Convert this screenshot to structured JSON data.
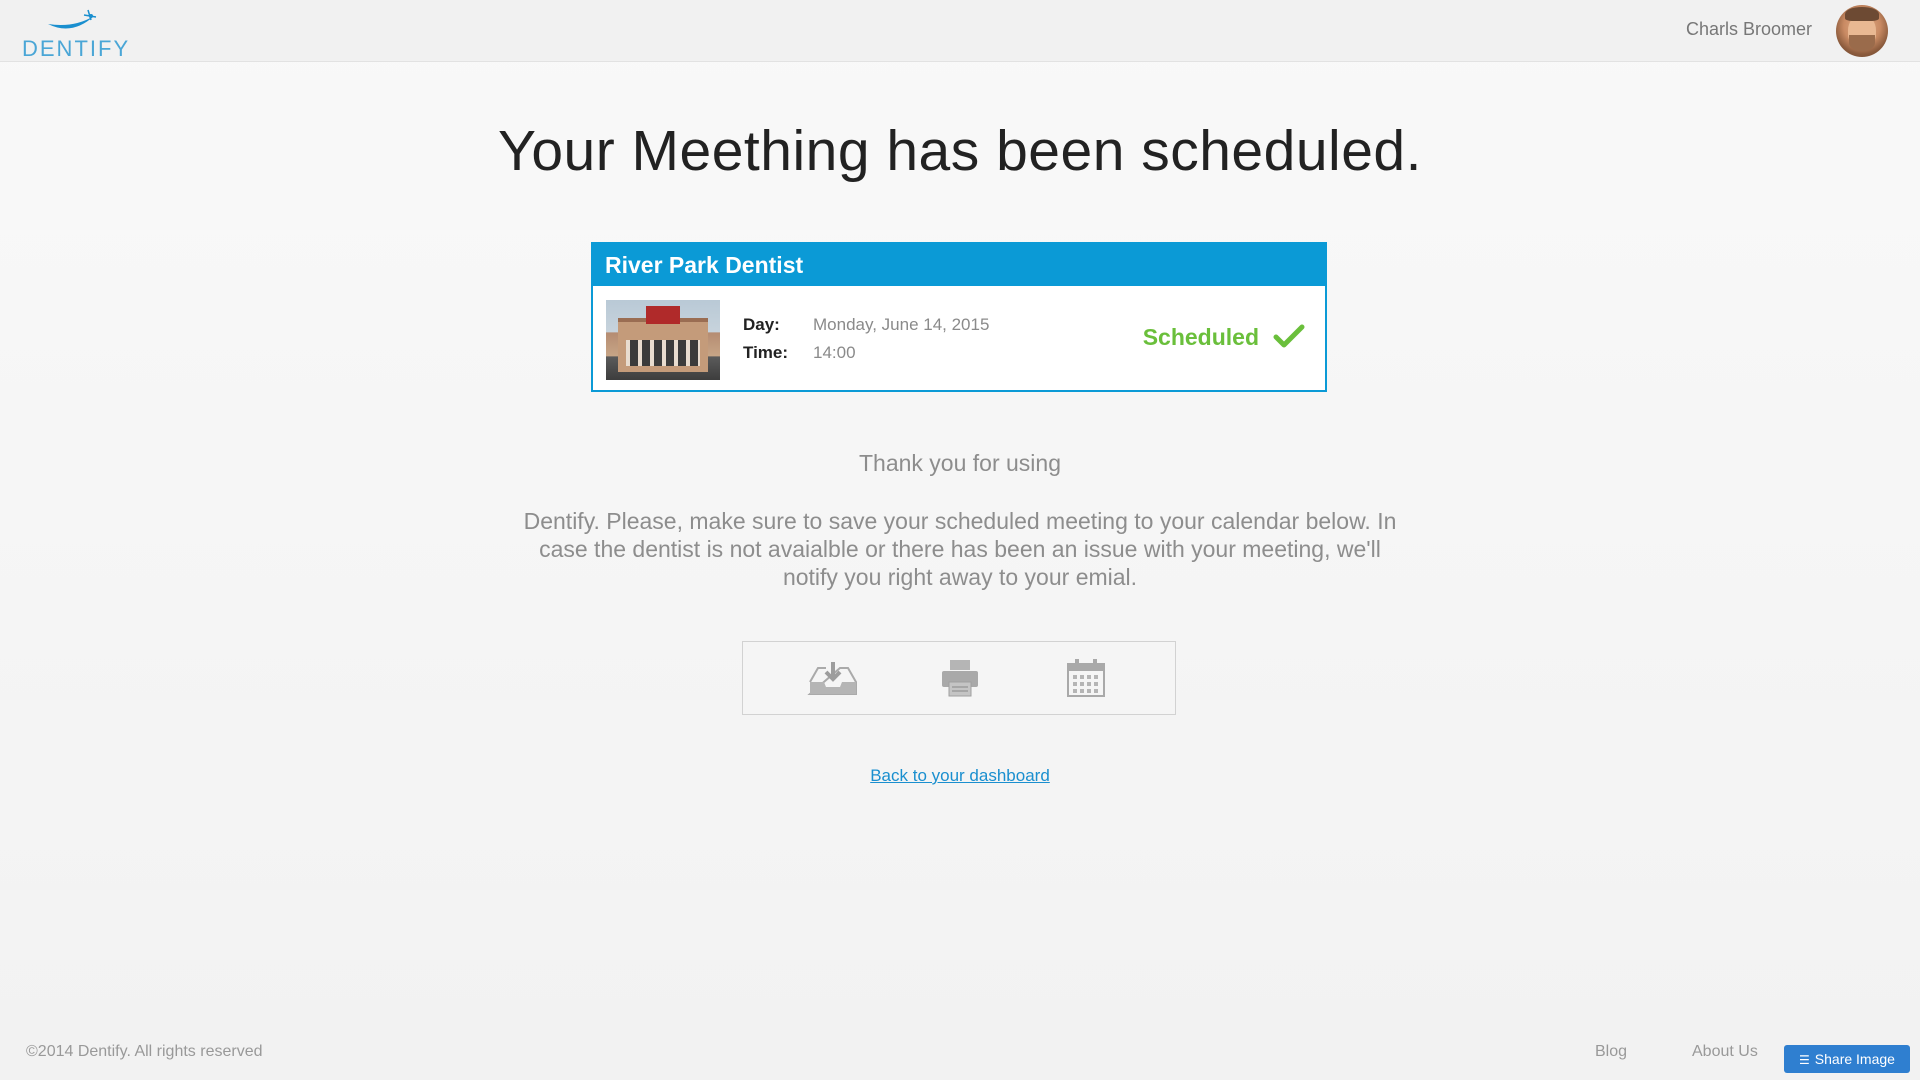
{
  "header": {
    "logo_text": "DENTIFY",
    "user_name": "Charls Broomer"
  },
  "main": {
    "title": "Your Meething has been scheduled.",
    "appointment": {
      "clinic_name": "River Park Dentist",
      "day_label": "Day:",
      "day_value": "Monday, June 14, 2015",
      "time_label": "Time:",
      "time_value": "14:00",
      "status": "Scheduled",
      "status_color": "#6abf3b"
    },
    "thanks_text": "Thank you for using",
    "message_text": "Dentify. Please, make sure to save your  scheduled meeting to your calendar below. In case the dentist is not avaialble or  there has been an issue with your meeting, we'll notify you right away to your emial.",
    "actions": [
      {
        "icon": "download-tray-icon"
      },
      {
        "icon": "printer-icon"
      },
      {
        "icon": "calendar-icon"
      }
    ],
    "back_link": "Back to your dashboard"
  },
  "footer": {
    "copyright": "©2014 Dentify. All rights reserved",
    "links": [
      "Blog",
      "About Us"
    ],
    "share_button": "Share Image"
  },
  "colors": {
    "brand_blue": "#0b9ad6",
    "link_blue": "#1a8fcf",
    "success_green": "#6abf3b",
    "share_blue": "#2f7fd0"
  }
}
